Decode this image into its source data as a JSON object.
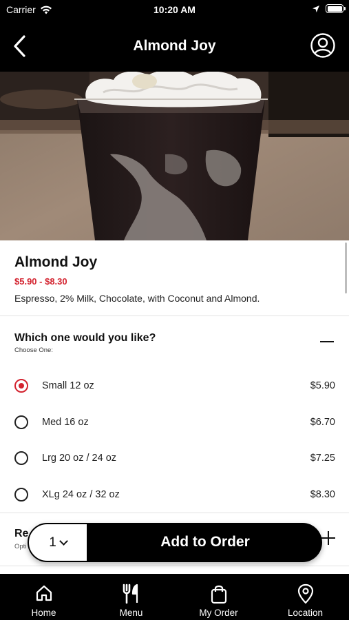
{
  "status_bar": {
    "carrier": "Carrier",
    "time": "10:20 AM"
  },
  "nav": {
    "title": "Almond Joy",
    "back_icon": "chevron-left-icon",
    "profile_icon": "user-circle-icon"
  },
  "product": {
    "name": "Almond Joy",
    "price_range": "$5.90 - $8.30",
    "description": "Espresso, 2% Milk, Chocolate, with Coconut and Almond."
  },
  "size_options": {
    "question": "Which one would you like?",
    "subtitle": "Choose One:",
    "selected_index": 0,
    "items": [
      {
        "label": "Small 12 oz",
        "price": "$5.90"
      },
      {
        "label": "Med 16 oz",
        "price": "$6.70"
      },
      {
        "label": "Lrg 20 oz / 24 oz",
        "price": "$7.25"
      },
      {
        "label": "XLg 24 oz / 32 oz",
        "price": "$8.30"
      }
    ]
  },
  "section2": {
    "title_visible": "Re",
    "subtitle_visible": "Opti"
  },
  "order_bar": {
    "quantity": "1",
    "add_label": "Add to Order"
  },
  "tabs": [
    {
      "label": "Home",
      "icon": "home-icon"
    },
    {
      "label": "Menu",
      "icon": "fork-knife-icon"
    },
    {
      "label": "My Order",
      "icon": "shopping-bag-icon"
    },
    {
      "label": "Location",
      "icon": "map-pin-icon"
    }
  ],
  "colors": {
    "accent": "#d3232f",
    "bar_background": "#000000",
    "text": "#111111"
  }
}
